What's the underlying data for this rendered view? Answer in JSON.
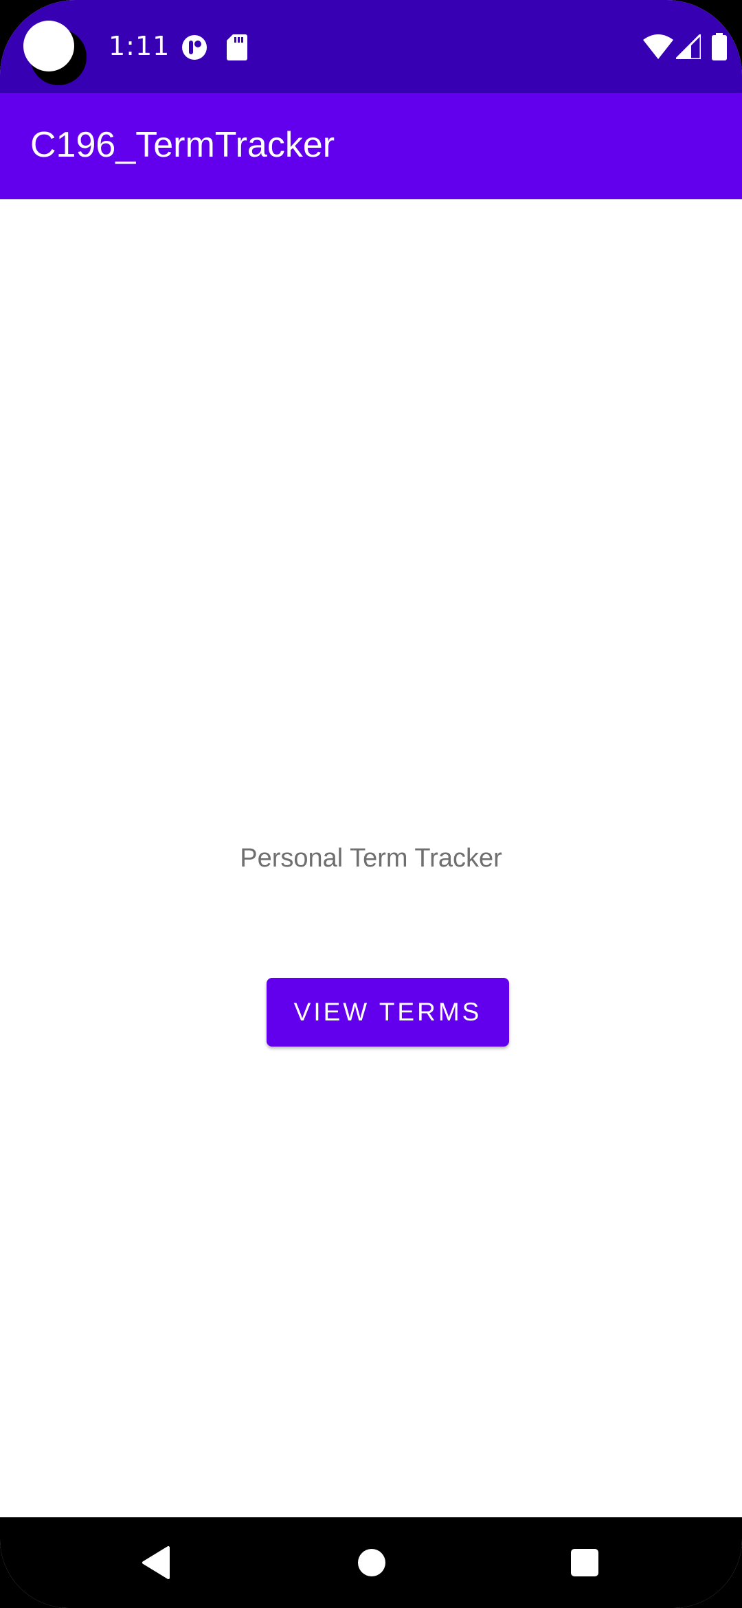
{
  "status_bar": {
    "time": "1:11",
    "background_color": "#3700B3",
    "icons": [
      "notification-app-icon",
      "sd-card-icon",
      "wifi-icon",
      "cell-signal-icon",
      "battery-icon"
    ]
  },
  "app_bar": {
    "title": "C196_TermTracker",
    "background_color": "#6200EE"
  },
  "main": {
    "subtitle": "Personal Term Tracker",
    "view_terms_label": "VIEW TERMS",
    "button_color": "#6200EE"
  },
  "nav_bar": {
    "icons": [
      "back-icon",
      "home-icon",
      "recents-icon"
    ]
  }
}
